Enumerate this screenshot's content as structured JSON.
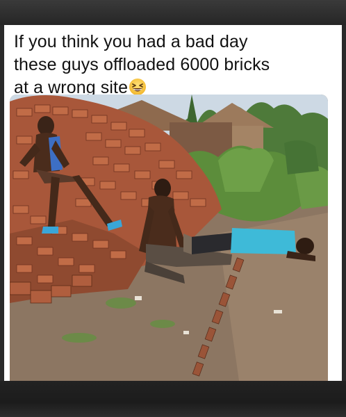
{
  "post": {
    "caption_line1": "If you think you had a bad day",
    "caption_line2": "these guys offloaded 6000 bricks",
    "caption_line3": "at a wrong site",
    "caption_emoji": "grinning-squinting-face-emoji"
  },
  "photo": {
    "subject": "brick-pile-with-exhausted-workers"
  },
  "colors": {
    "brick": "#b5613d",
    "brick_dark": "#7a3a22",
    "dirt": "#8d7762",
    "grass": "#5c8a3a",
    "sky": "#c9d6e3",
    "shirt_blue": "#3fb4d6"
  }
}
